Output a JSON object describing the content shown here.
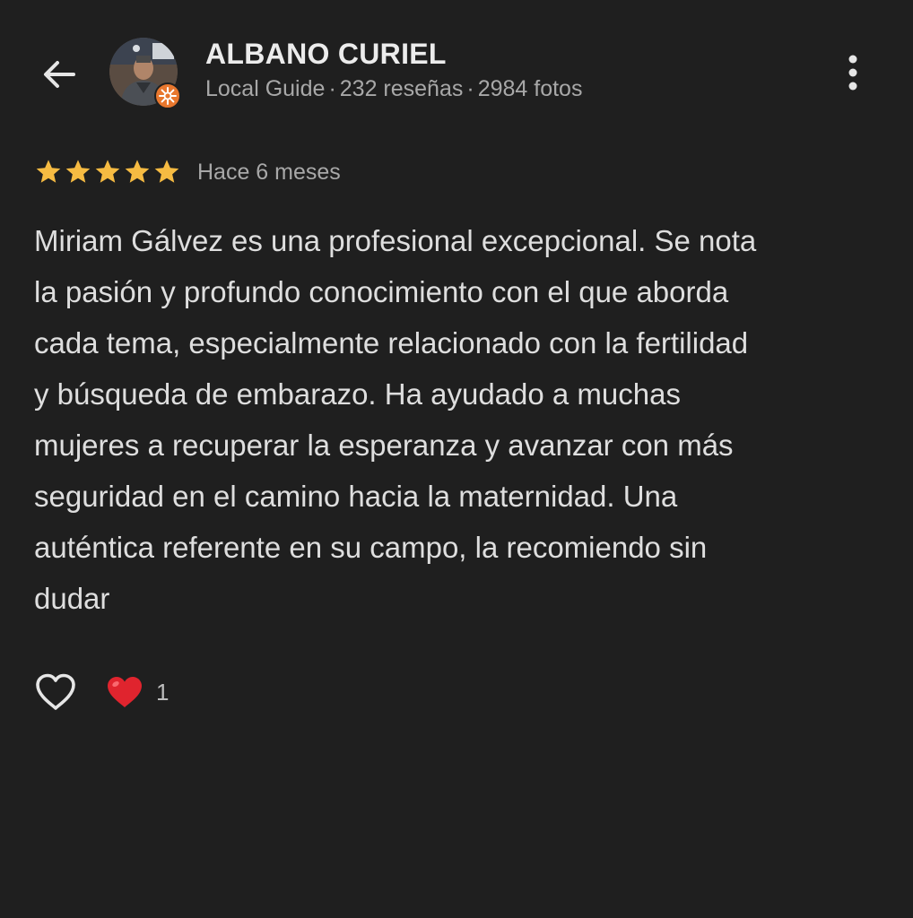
{
  "header": {
    "user_name": "ALBANO CURIEL",
    "guide_label": "Local Guide",
    "reviews_count": "232 reseñas",
    "photos_count": "2984 fotos",
    "separator": "·"
  },
  "review": {
    "rating": 5,
    "rating_max": 5,
    "date": "Hace 6 meses",
    "text_lines": [
      "Miriam Gálvez es una profesional excepcional. Se nota",
      "la pasión y profundo conocimiento con el que aborda",
      "cada tema, especialmente relacionado con la fertilidad",
      "y búsqueda de embarazo. Ha ayudado a muchas",
      "mujeres a recuperar la esperanza y avanzar con más",
      "seguridad en el camino hacia la maternidad. Una",
      "auténtica referente en su campo, la recomiendo sin",
      "dudar"
    ]
  },
  "actions": {
    "like_icon": "heart-outline-icon",
    "reaction_icon": "red-heart-icon",
    "reaction_count": "1"
  },
  "colors": {
    "background": "#1f1f1f",
    "star": "#f6bb42",
    "heart": "#e0242e",
    "badge": "#e8772e"
  }
}
